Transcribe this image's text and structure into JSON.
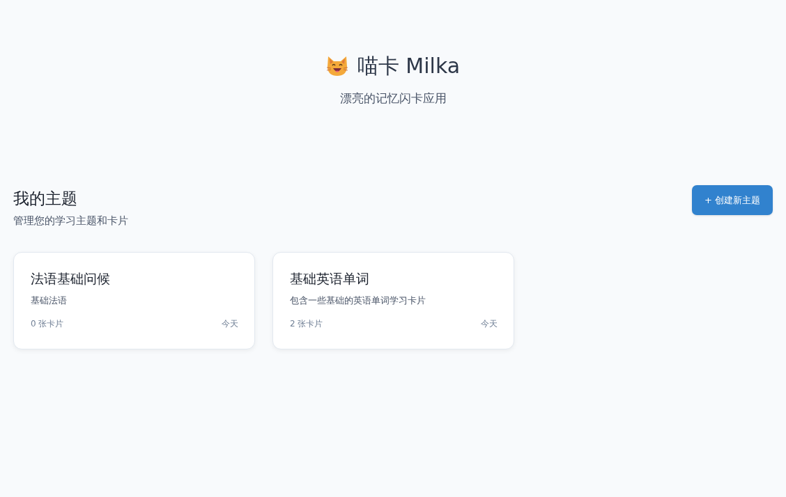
{
  "header": {
    "title": "喵卡 Milka",
    "subtitle": "漂亮的记忆闪卡应用"
  },
  "section": {
    "title": "我的主题",
    "subtitle": "管理您的学习主题和卡片",
    "create_button": "+ 创建新主题"
  },
  "topics": [
    {
      "name": "法语基础问候",
      "description": "基础法语",
      "card_count": "0 张卡片",
      "updated": "今天"
    },
    {
      "name": "基础英语单词",
      "description": "包含一些基础的英语单词学习卡片",
      "card_count": "2 张卡片",
      "updated": "今天"
    }
  ]
}
